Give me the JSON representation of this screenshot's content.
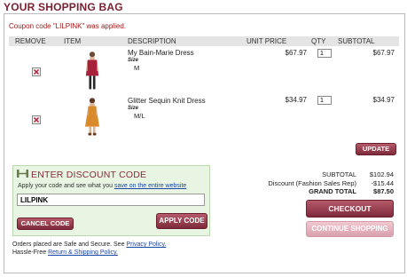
{
  "page_title": "YOUR SHOPPING BAG",
  "coupon_message": "Coupon code \"LILPINK\" was applied.",
  "columns": {
    "remove": "REMOVE",
    "item": "ITEM",
    "description": "DESCRIPTION",
    "unit_price": "UNIT PRICE",
    "qty": "QTY",
    "subtotal": "SUBTOTAL"
  },
  "items": [
    {
      "name": "My Bain-Marie Dress",
      "size_label": "Size",
      "size": "M",
      "unit_price": "$67.97",
      "qty": "1",
      "subtotal": "$67.97"
    },
    {
      "name": "Glitter Sequin Knit Dress",
      "size_label": "Size",
      "size": "M/L",
      "unit_price": "$34.97",
      "qty": "1",
      "subtotal": "$34.97"
    }
  ],
  "update_button": "UPDATE",
  "discount": {
    "title": "ENTER DISCOUNT CODE",
    "subtitle": "Apply your code and see what you",
    "subtitle_link": "save on the entire website",
    "code_value": "LILPINK",
    "cancel_button": "CANCEL CODE",
    "apply_button": "APPLY CODE"
  },
  "summary": {
    "subtotal_label": "SUBTOTAL",
    "subtotal_value": "$102.94",
    "discount_label": "Discount (Fashion Sales Rep)",
    "discount_value": "-$15.44",
    "grand_total_label": "GRAND TOTAL",
    "grand_total_value": "$87.50"
  },
  "checkout_button": "CHECKOUT",
  "continue_button": "CONTINUE SHOPPING",
  "footer": {
    "line1_text": "Orders placed are Safe and Secure. See",
    "line1_link": "Privacy Policy.",
    "line2_text": "Hassle-Free",
    "line2_link": "Return & Shipping Policy."
  },
  "colors": {
    "brand": "#7a2030",
    "discount_bg": "#e8f5e2",
    "link": "#1a46a8",
    "error_text": "#a01818"
  }
}
